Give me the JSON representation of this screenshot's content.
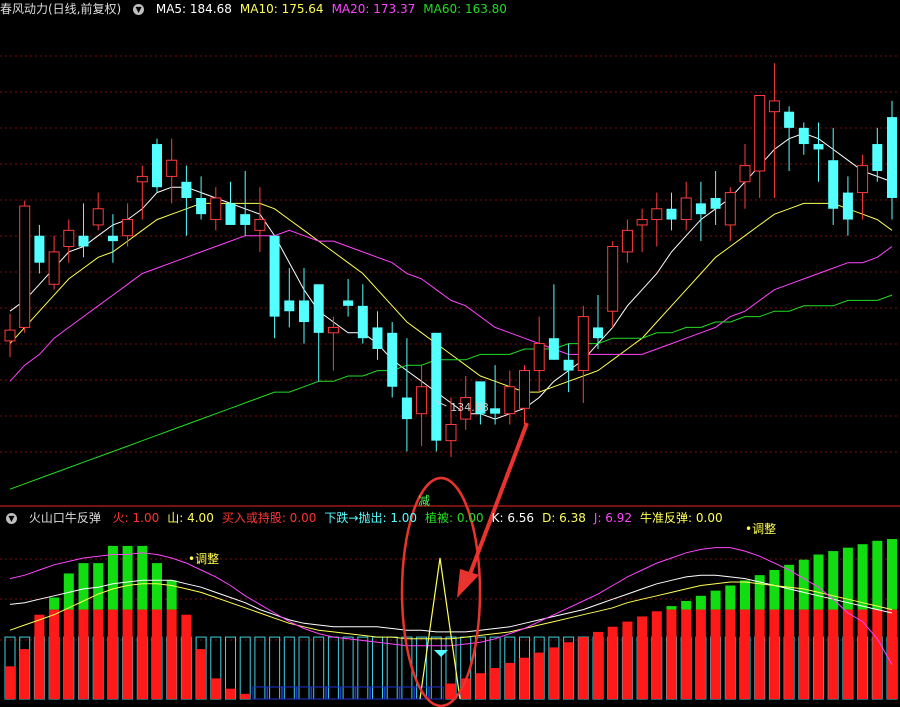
{
  "main_header": {
    "title": "春风动力(日线,前复权)",
    "indicators": [
      {
        "label": "MA5: 184.68",
        "color": "#ffffff"
      },
      {
        "label": "MA10: 175.64",
        "color": "#ffff55"
      },
      {
        "label": "MA20: 173.37",
        "color": "#ff44ff"
      },
      {
        "label": "MA60: 163.80",
        "color": "#22dd22"
      }
    ]
  },
  "sub_header": {
    "title": "火山口牛反弹",
    "indicators": [
      {
        "label": "火: 1.00",
        "color": "#ff3333"
      },
      {
        "label": "山: 4.00",
        "color": "#ffff55"
      },
      {
        "label": "买入或持股: 0.00",
        "color": "#ff3333"
      },
      {
        "label": "下跌→抛出: 1.00",
        "color": "#55ffff"
      },
      {
        "label": "植被: 0.00",
        "color": "#22dd22"
      },
      {
        "label": "K: 6.56",
        "color": "#ffffff"
      },
      {
        "label": "D: 6.38",
        "color": "#ffff55"
      },
      {
        "label": "J: 6.92",
        "color": "#ff44ff"
      },
      {
        "label": "牛准反弹: 0.00",
        "color": "#ffff55"
      }
    ]
  },
  "annotations": {
    "low_price": "134.88",
    "adjust_left": "调整",
    "adjust_right": "调整",
    "marker_text": "减"
  },
  "colors": {
    "up": "#ff3c3c",
    "down": "#54ffff",
    "ma5": "#ffffff",
    "ma10": "#ffff55",
    "ma20": "#ff44ff",
    "ma60": "#22dd22",
    "highlight": "#e8332f",
    "bar_red": "#ff1a1a",
    "bar_green": "#11dd11",
    "bar_cyan": "#3fd0e0",
    "bar_blue": "#2233cc"
  },
  "chart_data": [
    {
      "type": "candlestick",
      "title": "春风动力(日线,前复权)",
      "ylim": [
        126,
        215
      ],
      "ohlc": [
        [
          155.5,
          160.5,
          152.5,
          157.5
        ],
        [
          158,
          181.5,
          157,
          180.5
        ],
        [
          175,
          177,
          168,
          170
        ],
        [
          166,
          175,
          165,
          172
        ],
        [
          173,
          178,
          170,
          176
        ],
        [
          175,
          181,
          171,
          173
        ],
        [
          177,
          183,
          176,
          180
        ],
        [
          175,
          179,
          170,
          174
        ],
        [
          175,
          181,
          173,
          178
        ],
        [
          185,
          188,
          178,
          186
        ],
        [
          192,
          193,
          183,
          184
        ],
        [
          186,
          193,
          181,
          189
        ],
        [
          185,
          188,
          175,
          182
        ],
        [
          182,
          186,
          178,
          179
        ],
        [
          178,
          184,
          176,
          182
        ],
        [
          181,
          185,
          177,
          177
        ],
        [
          179,
          187,
          175,
          177
        ],
        [
          176,
          184,
          172,
          178
        ],
        [
          175,
          170,
          156,
          160
        ],
        [
          163,
          169,
          158,
          161
        ],
        [
          163,
          169,
          155,
          159
        ],
        [
          166,
          162,
          148,
          157
        ],
        [
          157,
          160,
          150,
          158
        ],
        [
          163,
          167,
          160,
          162
        ],
        [
          162,
          166,
          155,
          156
        ],
        [
          158,
          161,
          152,
          154
        ],
        [
          157,
          159,
          145,
          147
        ],
        [
          145,
          156,
          135,
          141
        ],
        [
          142,
          151,
          136,
          147
        ],
        [
          157,
          157,
          135,
          137
        ],
        [
          137,
          145,
          134,
          140
        ],
        [
          141,
          149,
          139,
          145
        ],
        [
          148,
          147,
          140,
          142
        ],
        [
          143,
          151,
          140,
          142
        ],
        [
          142,
          150,
          140,
          147
        ],
        [
          143,
          151,
          140,
          150
        ],
        [
          150,
          160,
          146,
          155
        ],
        [
          156,
          166,
          152,
          152
        ],
        [
          152,
          155,
          146,
          150
        ],
        [
          150,
          162,
          144,
          160
        ],
        [
          158,
          164,
          154,
          156
        ],
        [
          161,
          174,
          158,
          173
        ],
        [
          172,
          178,
          170,
          176
        ],
        [
          177,
          180,
          172,
          178
        ],
        [
          178,
          183,
          173,
          180
        ],
        [
          180,
          183,
          176,
          178
        ],
        [
          178,
          185,
          176,
          182
        ],
        [
          181,
          185,
          174,
          179
        ],
        [
          182,
          187,
          177,
          180
        ],
        [
          177,
          184,
          174,
          183
        ],
        [
          185,
          192,
          180,
          188
        ],
        [
          187,
          195,
          182,
          201
        ],
        [
          198,
          207,
          182,
          200
        ],
        [
          198,
          199,
          187,
          195
        ],
        [
          195,
          196,
          190,
          192
        ],
        [
          192,
          196,
          185,
          191
        ],
        [
          189,
          195,
          177,
          180
        ],
        [
          183,
          186,
          175,
          178
        ],
        [
          183,
          190,
          178,
          188
        ],
        [
          192,
          195,
          185,
          187
        ],
        [
          197,
          200,
          178,
          182
        ]
      ],
      "ma": {
        "MA5": [
          161,
          163,
          166,
          169,
          172,
          173,
          175,
          177,
          178,
          180,
          183,
          184,
          184,
          183,
          182,
          181,
          180,
          179,
          175,
          170,
          165,
          161,
          159,
          157,
          157,
          155,
          152,
          150,
          148,
          146,
          144,
          142,
          142,
          141,
          142,
          143,
          145,
          148,
          150,
          152,
          155,
          158,
          162,
          165,
          168,
          172,
          175,
          178,
          180,
          182,
          185,
          188,
          191,
          193,
          194,
          193,
          191,
          189,
          187,
          186,
          185
        ],
        "MA10": [
          155,
          158,
          161,
          164,
          167,
          169,
          171,
          172,
          174,
          176,
          178,
          179,
          180,
          181,
          181,
          181,
          181,
          181,
          180,
          178,
          176,
          174,
          172,
          170,
          168,
          165,
          162,
          159,
          157,
          155,
          153,
          151,
          149,
          148,
          147,
          146,
          146,
          147,
          148,
          149,
          150,
          152,
          154,
          156,
          159,
          162,
          165,
          168,
          171,
          173,
          175,
          177,
          179,
          180,
          181,
          181,
          181,
          180,
          179,
          178,
          176
        ],
        "MA20": [
          148,
          151,
          153,
          156,
          158,
          160,
          162,
          164,
          166,
          168,
          169,
          170,
          171,
          172,
          173,
          174,
          175,
          175,
          175,
          176,
          175,
          174,
          174,
          173,
          172,
          171,
          170,
          168,
          167,
          165,
          163,
          162,
          160,
          158,
          157,
          156,
          155,
          154,
          153,
          153,
          153,
          153,
          153,
          153,
          154,
          155,
          156,
          157,
          158,
          160,
          161,
          163,
          165,
          166,
          167,
          168,
          169,
          170,
          170,
          171,
          173
        ],
        "MA60": [
          128,
          129,
          130,
          131,
          132,
          133,
          134,
          135,
          136,
          137,
          138,
          139,
          140,
          141,
          142,
          143,
          144,
          145,
          146,
          146,
          147,
          148,
          148,
          149,
          149,
          150,
          150,
          151,
          151,
          152,
          152,
          152,
          153,
          153,
          153,
          154,
          154,
          154,
          155,
          155,
          155,
          156,
          156,
          156,
          157,
          157,
          158,
          158,
          159,
          159,
          160,
          160,
          161,
          161,
          162,
          162,
          162,
          163,
          163,
          163,
          164
        ]
      }
    },
    {
      "type": "bar",
      "title": "火山口牛反弹",
      "ylim": [
        0,
        100
      ],
      "values": [
        19,
        29,
        49,
        59,
        73,
        79,
        79,
        89,
        89,
        89,
        79,
        69,
        49,
        29,
        12,
        6,
        3,
        0,
        0,
        0,
        0,
        0,
        0,
        0,
        0,
        0,
        0,
        0,
        3,
        6,
        9,
        12,
        15,
        18,
        21,
        24,
        27,
        30,
        33,
        36,
        39,
        42,
        45,
        48,
        51,
        54,
        57,
        60,
        63,
        66,
        69,
        72,
        75,
        78,
        81,
        84,
        86,
        88,
        90,
        92,
        93
      ],
      "series_colors": [
        "red",
        "red",
        "red",
        "red",
        "red",
        "red",
        "red",
        "red",
        "red",
        "red",
        "red",
        "red",
        "red",
        "red",
        "red",
        "red",
        "red",
        "blue",
        "blue",
        "blue",
        "blue",
        "blue",
        "blue",
        "blue",
        "blue",
        "blue",
        "blue",
        "blue",
        "blue",
        "blue",
        "red",
        "red",
        "red",
        "red",
        "red",
        "red",
        "red",
        "red",
        "red",
        "red",
        "red",
        "red",
        "red",
        "red",
        "red",
        "red",
        "red",
        "red",
        "red",
        "red",
        "red",
        "red",
        "red",
        "red",
        "red",
        "red",
        "red",
        "red",
        "red",
        "red",
        "red"
      ],
      "lines": {
        "K": [
          55,
          56,
          58,
          60,
          62,
          64,
          65,
          67,
          68,
          69,
          69,
          69,
          67,
          65,
          62,
          59,
          56,
          52,
          49,
          46,
          44,
          43,
          42,
          42,
          42,
          42,
          41,
          40,
          40,
          39,
          39,
          39,
          40,
          41,
          42,
          44,
          46,
          48,
          50,
          52,
          55,
          58,
          61,
          64,
          67,
          69,
          71,
          72,
          72,
          71,
          70,
          68,
          66,
          64,
          62,
          60,
          58,
          56,
          54,
          52,
          50
        ],
        "D": [
          40,
          43,
          46,
          49,
          53,
          57,
          61,
          64,
          66,
          67,
          67,
          66,
          64,
          62,
          59,
          56,
          53,
          50,
          47,
          44,
          42,
          40,
          39,
          38,
          37,
          36,
          36,
          35,
          35,
          35,
          35,
          36,
          37,
          38,
          39,
          41,
          43,
          45,
          47,
          49,
          51,
          53,
          56,
          58,
          60,
          62,
          64,
          66,
          67,
          68,
          68,
          67,
          66,
          65,
          64,
          62,
          60,
          58,
          56,
          54,
          52
        ],
        "J": [
          70,
          72,
          75,
          78,
          80,
          82,
          83,
          84,
          84,
          85,
          84,
          82,
          79,
          75,
          71,
          66,
          60,
          55,
          50,
          45,
          41,
          38,
          36,
          35,
          34,
          33,
          32,
          31,
          31,
          31,
          31,
          32,
          33,
          35,
          38,
          41,
          45,
          49,
          53,
          57,
          61,
          66,
          71,
          75,
          79,
          82,
          85,
          87,
          88,
          88,
          86,
          83,
          79,
          75,
          70,
          65,
          58,
          50,
          45,
          35,
          20
        ]
      }
    }
  ]
}
